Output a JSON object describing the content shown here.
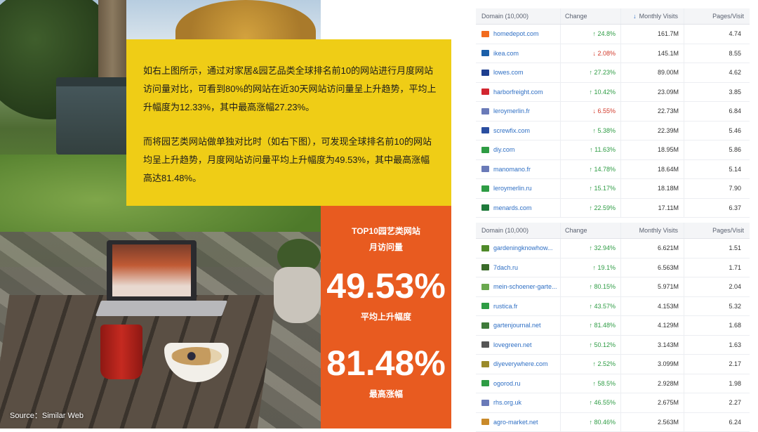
{
  "source_note": "Source：Similar Web",
  "card": {
    "para1": "如右上图所示，通过对家居&园艺品类全球排名前10的网站进行月度网站访问量对比，可看到80%的网站在近30天网站访问量呈上升趋势，平均上升幅度为12.33%，其中最高涨幅27.23%。",
    "para2": "而将园艺类网站做单独对比时（如右下图），可发现全球排名前10的网站均呈上升趋势，月度网站访问量平均上升幅度为49.53%，其中最高涨幅高达81.48%。"
  },
  "stat": {
    "title_line1": "TOP10园艺类网站",
    "title_line2": "月访问量",
    "avg_value": "49.53%",
    "avg_label": "平均上升幅度",
    "max_value": "81.48%",
    "max_label": "最高涨幅"
  },
  "table1": {
    "headers": {
      "domain": "Domain (10,000)",
      "change": "Change",
      "visits": "Monthly Visits",
      "pages": "Pages/Visit"
    },
    "rows": [
      {
        "domain": "homedepot.com",
        "icon": "homedepot-icon",
        "color": "#f26b1d",
        "dir": "up",
        "change": "24.8%",
        "visits": "161.7M",
        "pages": "4.74"
      },
      {
        "domain": "ikea.com",
        "icon": "ikea-icon",
        "color": "#1b5fa8",
        "dir": "down",
        "change": "2.08%",
        "visits": "145.1M",
        "pages": "8.55"
      },
      {
        "domain": "lowes.com",
        "icon": "lowes-icon",
        "color": "#1e3f8f",
        "dir": "up",
        "change": "27.23%",
        "visits": "89.00M",
        "pages": "4.62"
      },
      {
        "domain": "harborfreight.com",
        "icon": "harborfreight-icon",
        "color": "#d22630",
        "dir": "up",
        "change": "10.42%",
        "visits": "23.09M",
        "pages": "3.85"
      },
      {
        "domain": "leroymerlin.fr",
        "icon": "globe-icon",
        "color": "#6a7ab8",
        "dir": "down",
        "change": "6.55%",
        "visits": "22.73M",
        "pages": "6.84"
      },
      {
        "domain": "screwfix.com",
        "icon": "screwfix-icon",
        "color": "#2a4ea0",
        "dir": "up",
        "change": "5.38%",
        "visits": "22.39M",
        "pages": "5.46"
      },
      {
        "domain": "diy.com",
        "icon": "diy-icon",
        "color": "#2e9c44",
        "dir": "up",
        "change": "11.63%",
        "visits": "18.95M",
        "pages": "5.86"
      },
      {
        "domain": "manomano.fr",
        "icon": "globe-icon",
        "color": "#6a7ab8",
        "dir": "up",
        "change": "14.78%",
        "visits": "18.64M",
        "pages": "5.14"
      },
      {
        "domain": "leroymerlin.ru",
        "icon": "leroymerlin-icon",
        "color": "#2e9c44",
        "dir": "up",
        "change": "15.17%",
        "visits": "18.18M",
        "pages": "7.90"
      },
      {
        "domain": "menards.com",
        "icon": "menards-icon",
        "color": "#1f7a3b",
        "dir": "up",
        "change": "22.59%",
        "visits": "17.11M",
        "pages": "6.37"
      }
    ]
  },
  "table2": {
    "headers": {
      "domain": "Domain (10,000)",
      "change": "Change",
      "visits": "Monthly Visits",
      "pages": "Pages/Visit"
    },
    "rows": [
      {
        "domain": "gardeningknowhow...",
        "icon": "gardeningknowhow-icon",
        "color": "#4f8a2a",
        "dir": "up",
        "change": "32.94%",
        "visits": "6.621M",
        "pages": "1.51"
      },
      {
        "domain": "7dach.ru",
        "icon": "7dach-icon",
        "color": "#3a6b2a",
        "dir": "up",
        "change": "19.1%",
        "visits": "6.563M",
        "pages": "1.71"
      },
      {
        "domain": "mein-schoener-garte...",
        "icon": "g-icon",
        "color": "#6aa84f",
        "dir": "up",
        "change": "80.15%",
        "visits": "5.971M",
        "pages": "2.04"
      },
      {
        "domain": "rustica.fr",
        "icon": "clover-icon",
        "color": "#2e9c44",
        "dir": "up",
        "change": "43.57%",
        "visits": "4.153M",
        "pages": "5.32"
      },
      {
        "domain": "gartenjournal.net",
        "icon": "gartenjournal-icon",
        "color": "#3e7a3a",
        "dir": "up",
        "change": "81.48%",
        "visits": "4.129M",
        "pages": "1.68"
      },
      {
        "domain": "lovegreen.net",
        "icon": "lovegreen-icon",
        "color": "#555555",
        "dir": "up",
        "change": "50.12%",
        "visits": "3.143M",
        "pages": "1.63"
      },
      {
        "domain": "diyeverywhere.com",
        "icon": "diyeverywhere-icon",
        "color": "#9a8a2a",
        "dir": "up",
        "change": "2.52%",
        "visits": "3.099M",
        "pages": "2.17"
      },
      {
        "domain": "ogorod.ru",
        "icon": "ogorod-icon",
        "color": "#2e9c44",
        "dir": "up",
        "change": "58.5%",
        "visits": "2.928M",
        "pages": "1.98"
      },
      {
        "domain": "rhs.org.uk",
        "icon": "globe-icon",
        "color": "#6a7ab8",
        "dir": "up",
        "change": "46.55%",
        "visits": "2.675M",
        "pages": "2.27"
      },
      {
        "domain": "agro-market.net",
        "icon": "agromarket-icon",
        "color": "#c98a2a",
        "dir": "up",
        "change": "80.46%",
        "visits": "2.563M",
        "pages": "6.24"
      }
    ]
  }
}
